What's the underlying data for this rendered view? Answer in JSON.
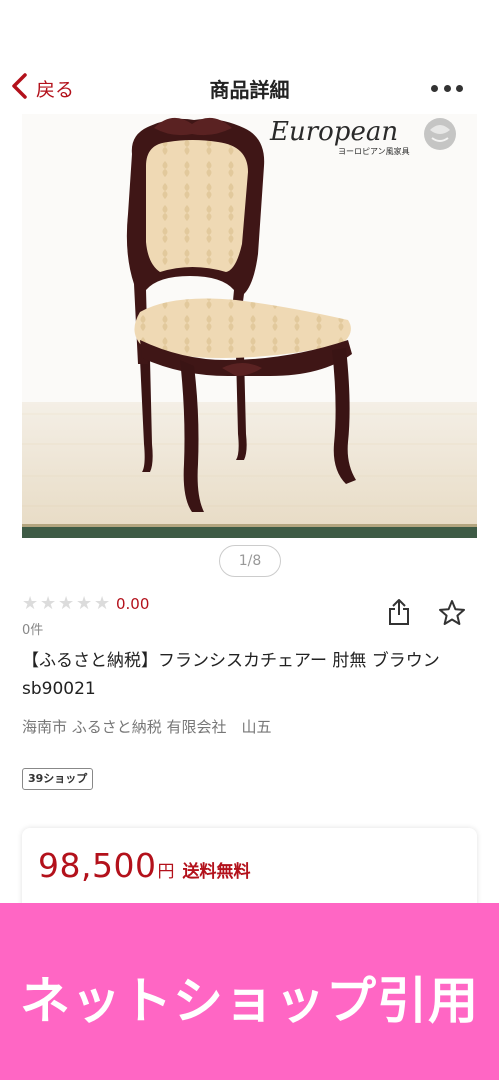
{
  "nav": {
    "back_label": "戻る",
    "title": "商品詳細"
  },
  "image": {
    "watermark_script": "European",
    "watermark_sub": "ヨーロピアン風家具",
    "pager": "1/8"
  },
  "rating": {
    "value": "0.00",
    "count": "0件",
    "stars": 5
  },
  "product": {
    "title": "【ふるさと納税】フランシスカチェアー 肘無 ブラウン sb90021",
    "shop": "海南市 ふるさと納税 有限会社　山五",
    "badge": "39ショップ"
  },
  "price": {
    "value": "98,500",
    "unit": "円",
    "shipping": "送料無料"
  },
  "banner": {
    "text": "ネットショップ引用"
  },
  "colors": {
    "accent": "#b3111b",
    "banner": "#ff66c4"
  },
  "icons": {
    "back": "chevron-left-icon",
    "more": "more-horizontal-icon",
    "share": "share-icon",
    "favorite": "star-outline-icon"
  }
}
